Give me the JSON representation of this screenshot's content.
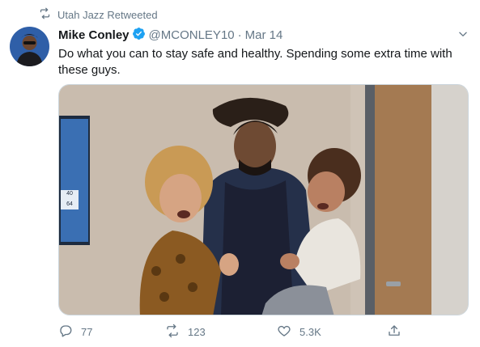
{
  "retweet_context": {
    "label": "Utah Jazz Retweeted"
  },
  "tweet": {
    "author_name": "Mike Conley",
    "handle": "@MCONLEY10",
    "separator": "·",
    "date": "Mar 14",
    "text": "Do what you can to stay safe and healthy. Spending some extra time with these guys.",
    "media": {
      "scoreboard_values": [
        "40",
        "64"
      ]
    }
  },
  "actions": {
    "replies": "77",
    "retweets": "123",
    "likes": "5.3K"
  },
  "colors": {
    "accent": "#1da1f2",
    "secondary_text": "#657786",
    "primary_text": "#14171a"
  }
}
